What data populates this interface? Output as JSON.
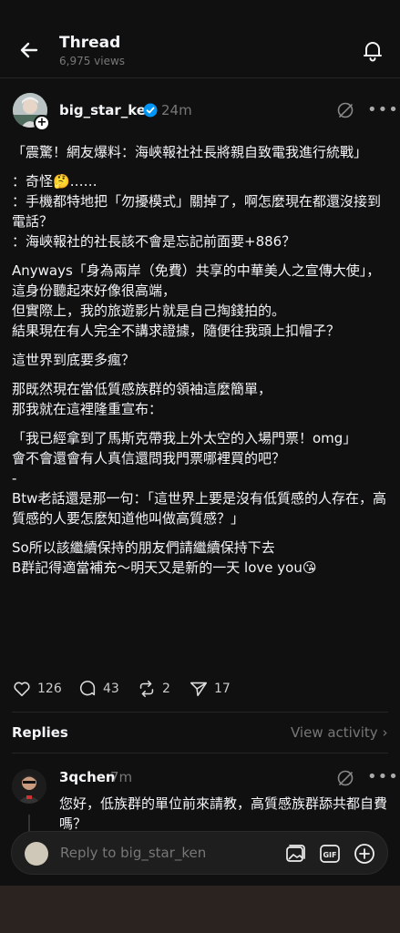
{
  "header": {
    "title": "Thread",
    "views": "6,975 views"
  },
  "post": {
    "username": "big_star_ken",
    "time": "24m",
    "paragraphs": [
      "「震驚！網友爆料：海峽報社社長將親自致電我進行統戰」",
      "：奇怪🤔……\n：手機都特地把「勿擾模式」關掉了，啊怎麼現在都還沒接到電話？\n：海峽報社的社長該不會是忘記前面要+886？",
      "Anyways「身為兩岸（免費）共享的中華美人之宣傳大使」，\n這身份聽起來好像很高端，\n但實際上，我的旅遊影片就是自己掏錢拍的。\n結果現在有人完全不講求證據，隨便往我頭上扣帽子？",
      "這世界到底要多瘋？",
      "那既然現在當低質感族群的領袖這麼簡單，\n那我就在這裡隆重宣布：",
      "「我已經拿到了馬斯克帶我上外太空的入場門票！omg」\n會不會還會有人真信還問我門票哪裡買的吧？\n-\nBtw老話還是那一句：「這世界上要是沒有低質感的人存在，高質感的人要怎麼知道他叫做高質感？」",
      "So所以該繼續保持的朋友們請繼續保持下去\nB群記得適當補充～明天又是新的一天 love you😘"
    ],
    "likes": "126",
    "comments": "43",
    "reposts": "2",
    "shares": "17"
  },
  "replies_section": {
    "label": "Replies",
    "view_activity": "View activity"
  },
  "reply": {
    "username": "3qchen",
    "time": "7m",
    "text": "您好，低族群的單位前來請教，高質感族群舔共都自費嗎？"
  },
  "composer": {
    "placeholder": "Reply to big_star_ken"
  },
  "colors": {
    "background": "#101010",
    "verified": "#0095f6",
    "muted": "#777777"
  }
}
